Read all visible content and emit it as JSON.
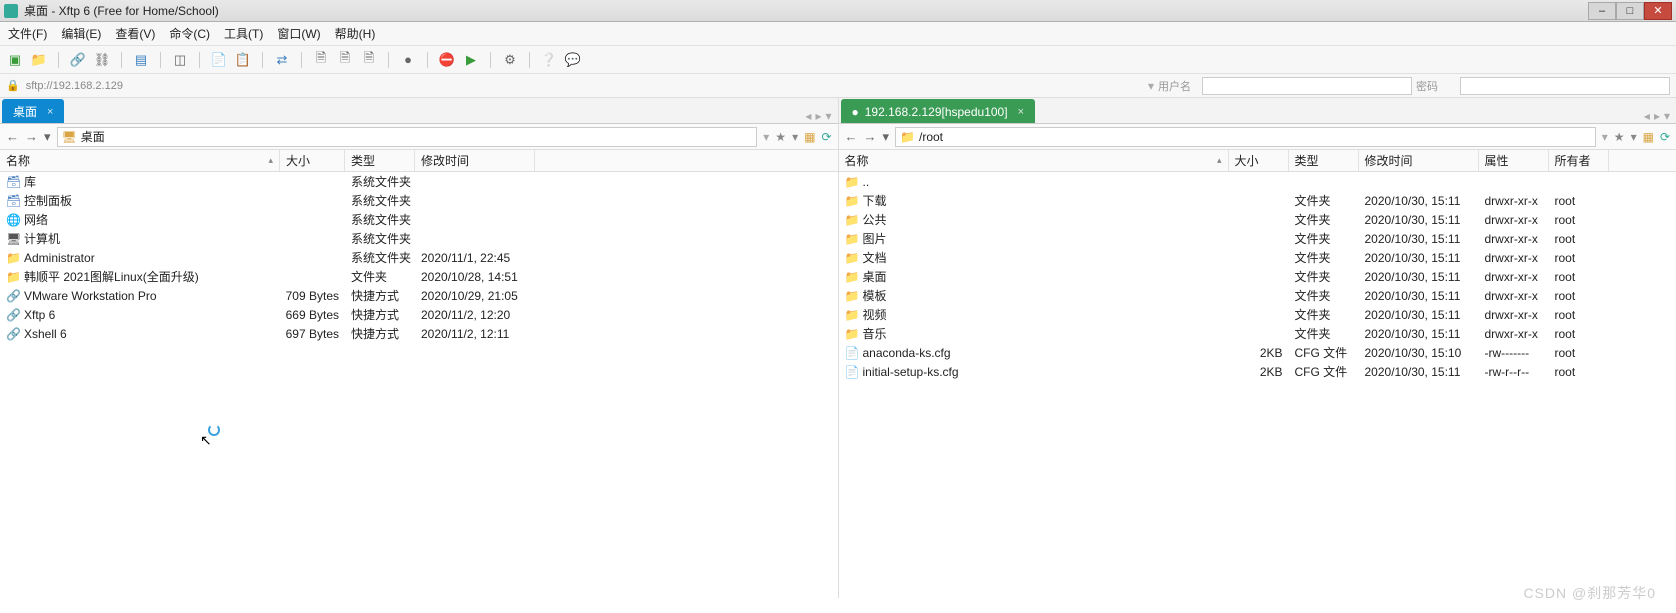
{
  "window": {
    "title": "桌面 - Xftp 6 (Free for Home/School)"
  },
  "menu": {
    "file": "文件(F)",
    "edit": "编辑(E)",
    "view": "查看(V)",
    "commands": "命令(C)",
    "tools": "工具(T)",
    "window": "窗口(W)",
    "help": "帮助(H)"
  },
  "address": {
    "url": "sftp://192.168.2.129",
    "user_label": "用户名",
    "pass_label": "密码"
  },
  "local": {
    "tab": "桌面",
    "path": "桌面",
    "columns": {
      "name": "名称",
      "size": "大小",
      "type": "类型",
      "modified": "修改时间"
    },
    "rows": [
      {
        "icon": "sys",
        "name": "库",
        "size": "",
        "type": "系统文件夹",
        "modified": ""
      },
      {
        "icon": "sys",
        "name": "控制面板",
        "size": "",
        "type": "系统文件夹",
        "modified": ""
      },
      {
        "icon": "net",
        "name": "网络",
        "size": "",
        "type": "系统文件夹",
        "modified": ""
      },
      {
        "icon": "pc",
        "name": "计算机",
        "size": "",
        "type": "系统文件夹",
        "modified": ""
      },
      {
        "icon": "fold",
        "name": "Administrator",
        "size": "",
        "type": "系统文件夹",
        "modified": "2020/11/1, 22:45"
      },
      {
        "icon": "fold",
        "name": "韩顺平 2021图解Linux(全面升级)",
        "size": "",
        "type": "文件夹",
        "modified": "2020/10/28, 14:51"
      },
      {
        "icon": "app",
        "name": "VMware Workstation Pro",
        "size": "709 Bytes",
        "type": "快捷方式",
        "modified": "2020/10/29, 21:05"
      },
      {
        "icon": "app",
        "name": "Xftp 6",
        "size": "669 Bytes",
        "type": "快捷方式",
        "modified": "2020/11/2, 12:20"
      },
      {
        "icon": "app",
        "name": "Xshell 6",
        "size": "697 Bytes",
        "type": "快捷方式",
        "modified": "2020/11/2, 12:11"
      }
    ]
  },
  "remote": {
    "tab": "192.168.2.129[hspedu100]",
    "path": "/root",
    "columns": {
      "name": "名称",
      "size": "大小",
      "type": "类型",
      "modified": "修改时间",
      "attr": "属性",
      "owner": "所有者"
    },
    "rows": [
      {
        "icon": "fold",
        "name": "..",
        "size": "",
        "type": "",
        "modified": "",
        "attr": "",
        "owner": ""
      },
      {
        "icon": "fold",
        "name": "下载",
        "size": "",
        "type": "文件夹",
        "modified": "2020/10/30, 15:11",
        "attr": "drwxr-xr-x",
        "owner": "root"
      },
      {
        "icon": "fold",
        "name": "公共",
        "size": "",
        "type": "文件夹",
        "modified": "2020/10/30, 15:11",
        "attr": "drwxr-xr-x",
        "owner": "root"
      },
      {
        "icon": "fold",
        "name": "图片",
        "size": "",
        "type": "文件夹",
        "modified": "2020/10/30, 15:11",
        "attr": "drwxr-xr-x",
        "owner": "root"
      },
      {
        "icon": "fold",
        "name": "文档",
        "size": "",
        "type": "文件夹",
        "modified": "2020/10/30, 15:11",
        "attr": "drwxr-xr-x",
        "owner": "root"
      },
      {
        "icon": "fold",
        "name": "桌面",
        "size": "",
        "type": "文件夹",
        "modified": "2020/10/30, 15:11",
        "attr": "drwxr-xr-x",
        "owner": "root"
      },
      {
        "icon": "fold",
        "name": "模板",
        "size": "",
        "type": "文件夹",
        "modified": "2020/10/30, 15:11",
        "attr": "drwxr-xr-x",
        "owner": "root"
      },
      {
        "icon": "fold",
        "name": "视频",
        "size": "",
        "type": "文件夹",
        "modified": "2020/10/30, 15:11",
        "attr": "drwxr-xr-x",
        "owner": "root"
      },
      {
        "icon": "fold",
        "name": "音乐",
        "size": "",
        "type": "文件夹",
        "modified": "2020/10/30, 15:11",
        "attr": "drwxr-xr-x",
        "owner": "root"
      },
      {
        "icon": "file",
        "name": "anaconda-ks.cfg",
        "size": "2KB",
        "type": "CFG 文件",
        "modified": "2020/10/30, 15:10",
        "attr": "-rw-------",
        "owner": "root"
      },
      {
        "icon": "file",
        "name": "initial-setup-ks.cfg",
        "size": "2KB",
        "type": "CFG 文件",
        "modified": "2020/10/30, 15:11",
        "attr": "-rw-r--r--",
        "owner": "root"
      }
    ]
  },
  "watermark": "CSDN @刹那芳华0"
}
